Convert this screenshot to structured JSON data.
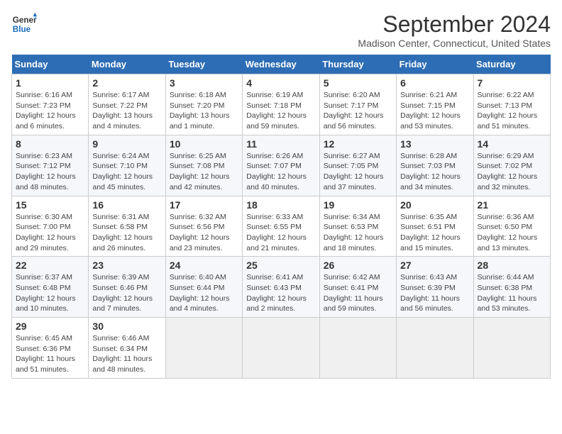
{
  "header": {
    "logo_line1": "General",
    "logo_line2": "Blue",
    "month": "September 2024",
    "location": "Madison Center, Connecticut, United States"
  },
  "weekdays": [
    "Sunday",
    "Monday",
    "Tuesday",
    "Wednesday",
    "Thursday",
    "Friday",
    "Saturday"
  ],
  "weeks": [
    [
      {
        "day": 1,
        "sunrise": "6:16 AM",
        "sunset": "7:23 PM",
        "daylight": "12 hours and 6 minutes."
      },
      {
        "day": 2,
        "sunrise": "6:17 AM",
        "sunset": "7:22 PM",
        "daylight": "13 hours and 4 minutes."
      },
      {
        "day": 3,
        "sunrise": "6:18 AM",
        "sunset": "7:20 PM",
        "daylight": "13 hours and 1 minute."
      },
      {
        "day": 4,
        "sunrise": "6:19 AM",
        "sunset": "7:18 PM",
        "daylight": "12 hours and 59 minutes."
      },
      {
        "day": 5,
        "sunrise": "6:20 AM",
        "sunset": "7:17 PM",
        "daylight": "12 hours and 56 minutes."
      },
      {
        "day": 6,
        "sunrise": "6:21 AM",
        "sunset": "7:15 PM",
        "daylight": "12 hours and 53 minutes."
      },
      {
        "day": 7,
        "sunrise": "6:22 AM",
        "sunset": "7:13 PM",
        "daylight": "12 hours and 51 minutes."
      }
    ],
    [
      {
        "day": 8,
        "sunrise": "6:23 AM",
        "sunset": "7:12 PM",
        "daylight": "12 hours and 48 minutes."
      },
      {
        "day": 9,
        "sunrise": "6:24 AM",
        "sunset": "7:10 PM",
        "daylight": "12 hours and 45 minutes."
      },
      {
        "day": 10,
        "sunrise": "6:25 AM",
        "sunset": "7:08 PM",
        "daylight": "12 hours and 42 minutes."
      },
      {
        "day": 11,
        "sunrise": "6:26 AM",
        "sunset": "7:07 PM",
        "daylight": "12 hours and 40 minutes."
      },
      {
        "day": 12,
        "sunrise": "6:27 AM",
        "sunset": "7:05 PM",
        "daylight": "12 hours and 37 minutes."
      },
      {
        "day": 13,
        "sunrise": "6:28 AM",
        "sunset": "7:03 PM",
        "daylight": "12 hours and 34 minutes."
      },
      {
        "day": 14,
        "sunrise": "6:29 AM",
        "sunset": "7:02 PM",
        "daylight": "12 hours and 32 minutes."
      }
    ],
    [
      {
        "day": 15,
        "sunrise": "6:30 AM",
        "sunset": "7:00 PM",
        "daylight": "12 hours and 29 minutes."
      },
      {
        "day": 16,
        "sunrise": "6:31 AM",
        "sunset": "6:58 PM",
        "daylight": "12 hours and 26 minutes."
      },
      {
        "day": 17,
        "sunrise": "6:32 AM",
        "sunset": "6:56 PM",
        "daylight": "12 hours and 23 minutes."
      },
      {
        "day": 18,
        "sunrise": "6:33 AM",
        "sunset": "6:55 PM",
        "daylight": "12 hours and 21 minutes."
      },
      {
        "day": 19,
        "sunrise": "6:34 AM",
        "sunset": "6:53 PM",
        "daylight": "12 hours and 18 minutes."
      },
      {
        "day": 20,
        "sunrise": "6:35 AM",
        "sunset": "6:51 PM",
        "daylight": "12 hours and 15 minutes."
      },
      {
        "day": 21,
        "sunrise": "6:36 AM",
        "sunset": "6:50 PM",
        "daylight": "12 hours and 13 minutes."
      }
    ],
    [
      {
        "day": 22,
        "sunrise": "6:37 AM",
        "sunset": "6:48 PM",
        "daylight": "12 hours and 10 minutes."
      },
      {
        "day": 23,
        "sunrise": "6:39 AM",
        "sunset": "6:46 PM",
        "daylight": "12 hours and 7 minutes."
      },
      {
        "day": 24,
        "sunrise": "6:40 AM",
        "sunset": "6:44 PM",
        "daylight": "12 hours and 4 minutes."
      },
      {
        "day": 25,
        "sunrise": "6:41 AM",
        "sunset": "6:43 PM",
        "daylight": "12 hours and 2 minutes."
      },
      {
        "day": 26,
        "sunrise": "6:42 AM",
        "sunset": "6:41 PM",
        "daylight": "11 hours and 59 minutes."
      },
      {
        "day": 27,
        "sunrise": "6:43 AM",
        "sunset": "6:39 PM",
        "daylight": "11 hours and 56 minutes."
      },
      {
        "day": 28,
        "sunrise": "6:44 AM",
        "sunset": "6:38 PM",
        "daylight": "11 hours and 53 minutes."
      }
    ],
    [
      {
        "day": 29,
        "sunrise": "6:45 AM",
        "sunset": "6:36 PM",
        "daylight": "11 hours and 51 minutes."
      },
      {
        "day": 30,
        "sunrise": "6:46 AM",
        "sunset": "6:34 PM",
        "daylight": "11 hours and 48 minutes."
      },
      null,
      null,
      null,
      null,
      null
    ]
  ]
}
